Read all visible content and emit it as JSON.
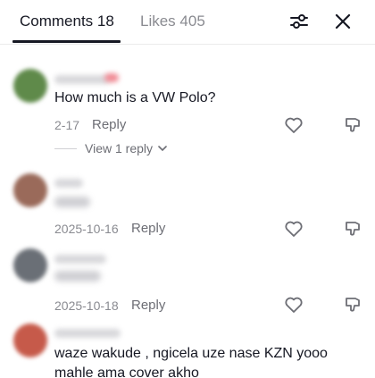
{
  "tabs": {
    "comments": "Comments 18",
    "likes": "Likes 405"
  },
  "icons": {
    "filter": "sliders-icon",
    "close": "close-icon",
    "like": "heart-outline-icon",
    "dislike": "thumbs-down-outline-icon"
  },
  "comments": [
    {
      "text": "How much is a VW Polo?",
      "date": "2-17",
      "reply_label": "Reply",
      "view_replies": "View 1 reply",
      "avatar_color": "#5f8a4a"
    },
    {
      "text": "",
      "date": "2025-10-16",
      "reply_label": "Reply",
      "avatar_color": "#9a6a5a"
    },
    {
      "text": "",
      "date": "2025-10-18",
      "reply_label": "Reply",
      "avatar_color": "#6a6f76"
    },
    {
      "text_line1": "waze wakude , ngicela uze nase KZN yooo",
      "text_line2": "mahle ama cover akho",
      "avatar_color": "#c65a4a"
    }
  ]
}
